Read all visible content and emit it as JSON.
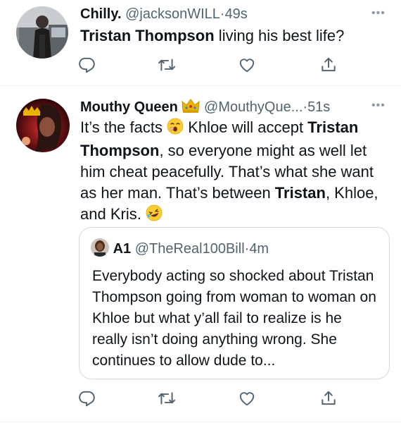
{
  "tweets": [
    {
      "name": "Chilly.",
      "handle": "@jacksonWILL",
      "dot": "·",
      "time": "49s",
      "more": "•••",
      "text_bold": "Tristan Thompson",
      "text_rest": " living his best life?"
    },
    {
      "name": "Mouthy Queen",
      "handle": "@MouthyQue...",
      "dot": "·",
      "time": "51s",
      "more": "•••",
      "line1_a": "It’s the facts ",
      "line1_b": " Khloe will accept ",
      "line1_bold": "Tristan",
      "line2_bold": "Thompson",
      "line2_rest": ", so everyone might as well let",
      "line3": "him cheat peacefully. That’s what she want",
      "line4": "as her man. That’s between ",
      "line4_bold": "Tristan",
      "line4_end": ", Khloe,",
      "line5": "and Kris. ",
      "quote": {
        "name": "A1",
        "handle": "@TheReal100Bill",
        "dot": "·",
        "time": "4m",
        "text": "Everybody acting so shocked about Tristan Thompson going from woman to woman on Khloe but what y’all fail to realize is he really isn’t doing anything wrong. She continues to allow dude to..."
      }
    }
  ],
  "icons": [
    "reply-icon",
    "retweet-icon",
    "like-icon",
    "share-icon",
    "crown-emoji",
    "yawning-face-emoji",
    "rolling-laughing-emoji"
  ],
  "colors": {
    "secondary_text": "#536471",
    "border": "#cfd9de",
    "divider": "#eff3f4",
    "crown": "#e8b400"
  }
}
